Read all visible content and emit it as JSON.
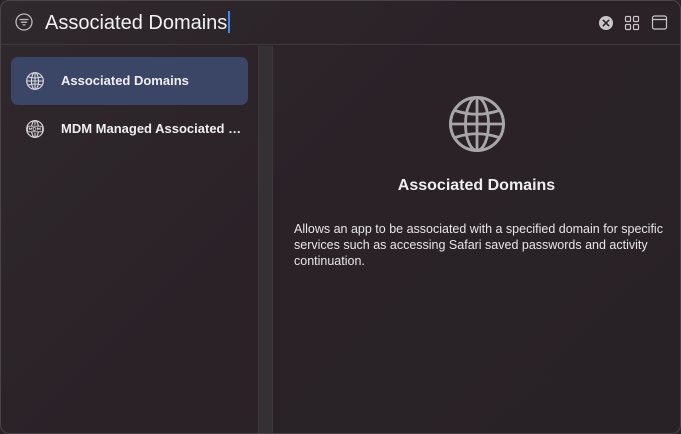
{
  "search": {
    "value": "Associated Domains"
  },
  "icons": {
    "filter": "filter-icon",
    "clear": "clear-icon",
    "grid": "grid-view-icon",
    "panel": "sidebar-panel-icon",
    "globe": "globe-icon",
    "mdm_globe": "mdm-globe-icon"
  },
  "sidebar": {
    "items": [
      {
        "label": "Associated Domains",
        "selected": true
      },
      {
        "label": "MDM Managed Associated Domains",
        "selected": false
      }
    ]
  },
  "detail": {
    "title": "Associated Domains",
    "description": "Allows an app to be associated with a specified domain for specific services such as accessing Safari saved passwords and activity continuation."
  },
  "colors": {
    "selection": "#3b4566",
    "caret": "#3d8cf5"
  }
}
